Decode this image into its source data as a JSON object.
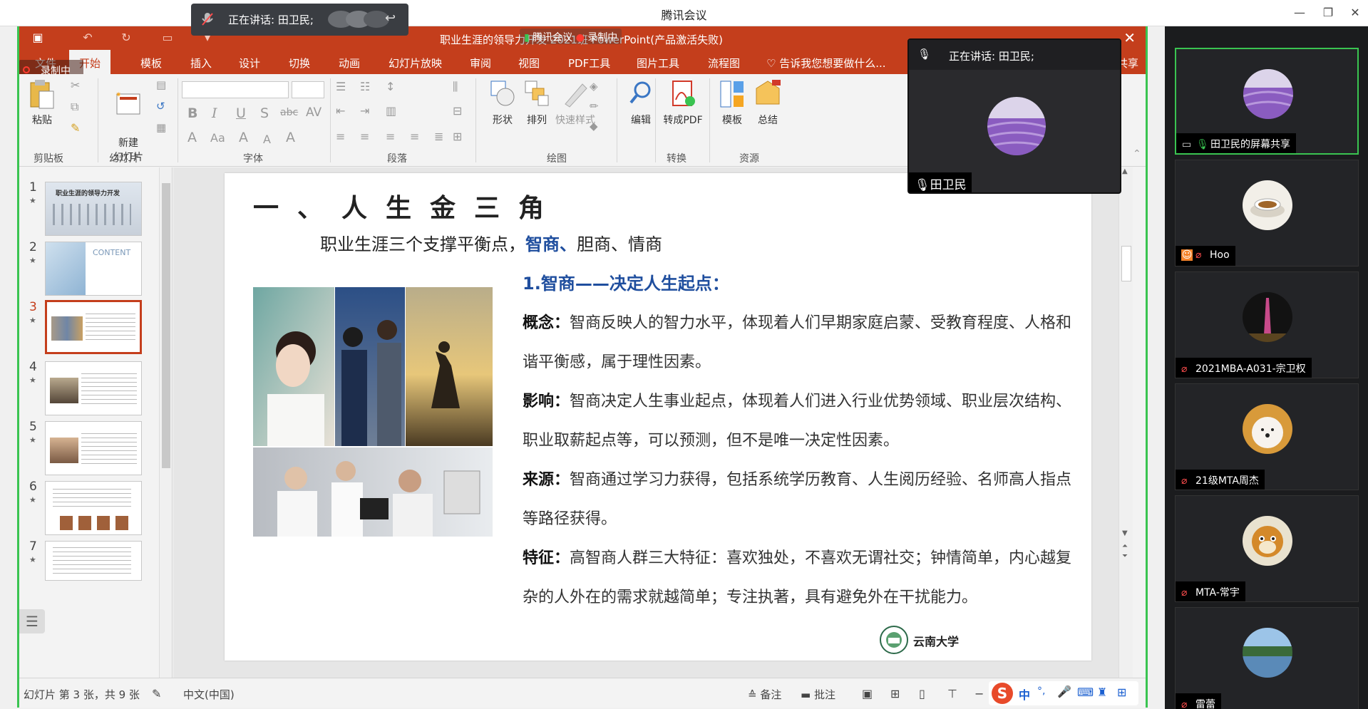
{
  "app": {
    "title": "腾讯会议",
    "speaking_toast": "正在讲话: 田卫民;",
    "win_minimize": "—",
    "win_restore": "❐",
    "win_close": "✕"
  },
  "ppt": {
    "doc_title": "职业生涯的领导力开发 2021班  PowerPoint(产品激活失败)",
    "meeting_badge": "腾讯会议",
    "recording_badge": "录制中",
    "rec_overlay": "录制中",
    "file_tab": "文件",
    "tabs": [
      "开始",
      "模板",
      "插入",
      "设计",
      "切换",
      "动画",
      "幻灯片放映",
      "审阅",
      "视图",
      "PDF工具",
      "图片工具",
      "流程图"
    ],
    "tell_me": "告诉我您想要做什么...",
    "share": "共享",
    "ribbon": {
      "paste": "粘贴",
      "new_slide": "新建\n幻灯片",
      "shape": "形状",
      "arrange": "排列",
      "quick_style": "快速样式",
      "edit": "编辑",
      "to_pdf": "转成PDF",
      "template": "模板",
      "summary": "总结",
      "groups": {
        "clipboard": "剪贴板",
        "slides": "幻灯片",
        "font": "字体",
        "paragraph": "段落",
        "drawing": "绘图",
        "convert": "转换",
        "resources": "资源"
      }
    },
    "thumbnails": [
      {
        "num": "1",
        "star": "★"
      },
      {
        "num": "2",
        "star": "★"
      },
      {
        "num": "3",
        "star": "★"
      },
      {
        "num": "4",
        "star": "★"
      },
      {
        "num": "5",
        "star": "★"
      },
      {
        "num": "6",
        "star": "★"
      },
      {
        "num": "7",
        "star": "★"
      }
    ],
    "thumb_text": {
      "t1": "职业生涯的领导力开发",
      "t2": "CONTENT"
    },
    "slide": {
      "title": "一、人生金三角",
      "subtitle_pre": "职业生涯三个支撑平衡点，",
      "subtitle_hl": "智商、",
      "subtitle_post": "胆商、情商",
      "heading": "1.智商——决定人生起点：",
      "concept_label": "概念：",
      "concept": "智商反映人的智力水平，体现着人们早期家庭启蒙、受教育程度、人格和谐平衡感，属于理性因素。",
      "impact_label": "影响：",
      "impact": "智商决定人生事业起点，体现着人们进入行业优势领域、职业层次结构、职业取薪起点等，可以预测，但不是唯一决定性因素。",
      "source_label": "来源：",
      "source": "智商通过学习力获得，包括系统学历教育、人生阅历经验、名师高人指点等路径获得。",
      "feature_label": "特征：",
      "feature": "高智商人群三大特征：喜欢独处，不喜欢无谓社交；钟情简单，内心越复杂的人外在的需求就越简单；专注执著，具有避免外在干扰能力。",
      "logo_text": "云南大学"
    },
    "status": {
      "slide_info": "幻灯片 第 3 张，共 9 张",
      "language": "中文(中国)",
      "notes": "备注",
      "comments": "批注"
    },
    "ime": {
      "lang": "中",
      "punct": "°,"
    }
  },
  "speaker_card": {
    "header": "正在讲话: 田卫民;",
    "name": "田卫民"
  },
  "participants": [
    {
      "name": "田卫民的屏幕共享",
      "icon": "screen-share-icon"
    },
    {
      "name": "Hoo",
      "icon": "mic-muted-icon"
    },
    {
      "name": "2021MBA-A031-宗卫权",
      "icon": "mic-muted-icon"
    },
    {
      "name": "21级MTA周杰",
      "icon": "mic-muted-icon"
    },
    {
      "name": "MTA-常宇",
      "icon": "mic-muted-icon"
    },
    {
      "name": "雷蕾",
      "icon": "mic-muted-icon"
    }
  ],
  "colors": {
    "ppt_red": "#c43e1c",
    "accent_green": "#3ac451",
    "heading_blue": "#1f4e9e"
  }
}
